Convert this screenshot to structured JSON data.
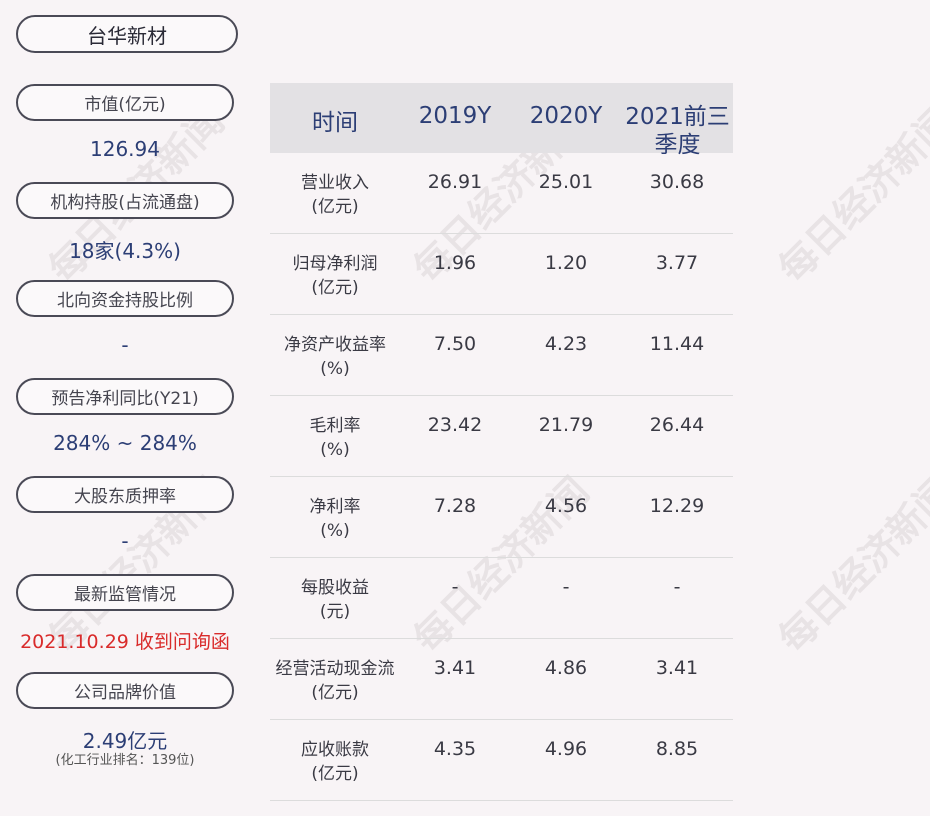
{
  "company": {
    "name": "台华新材"
  },
  "sidebar": {
    "items": [
      {
        "label": "市值(亿元)",
        "value": "126.94"
      },
      {
        "label": "机构持股(占流通盘)",
        "value": "18家(4.3%)"
      },
      {
        "label": "北向资金持股比例",
        "value": "-"
      },
      {
        "label": "预告净利同比(Y21)",
        "value": "284% ~ 284%"
      },
      {
        "label": "大股东质押率",
        "value": "-"
      },
      {
        "label": "最新监管情况",
        "value": "2021.10.29 收到问询函"
      },
      {
        "label": "公司品牌价值",
        "value": "2.49亿元",
        "sub": "(化工行业排名：139位)"
      }
    ]
  },
  "table": {
    "headers": [
      "时间",
      "2019Y",
      "2020Y",
      "2021前三季度"
    ],
    "rows": [
      {
        "label": "营业收入",
        "unit": "(亿元)",
        "values": [
          "26.91",
          "25.01",
          "30.68"
        ]
      },
      {
        "label": "归母净利润",
        "unit": "(亿元)",
        "values": [
          "1.96",
          "1.20",
          "3.77"
        ]
      },
      {
        "label": "净资产收益率",
        "unit": "(%)",
        "values": [
          "7.50",
          "4.23",
          "11.44"
        ]
      },
      {
        "label": "毛利率",
        "unit": "(%)",
        "values": [
          "23.42",
          "21.79",
          "26.44"
        ]
      },
      {
        "label": "净利率",
        "unit": "(%)",
        "values": [
          "7.28",
          "4.56",
          "12.29"
        ]
      },
      {
        "label": "每股收益",
        "unit": "(元)",
        "values": [
          "-",
          "-",
          "-"
        ]
      },
      {
        "label": "经营活动现金流",
        "unit": "(亿元)",
        "values": [
          "3.41",
          "4.86",
          "3.41"
        ]
      },
      {
        "label": "应收账款",
        "unit": "(亿元)",
        "values": [
          "4.35",
          "4.96",
          "8.85"
        ]
      }
    ]
  },
  "watermark": "每日经济新闻"
}
